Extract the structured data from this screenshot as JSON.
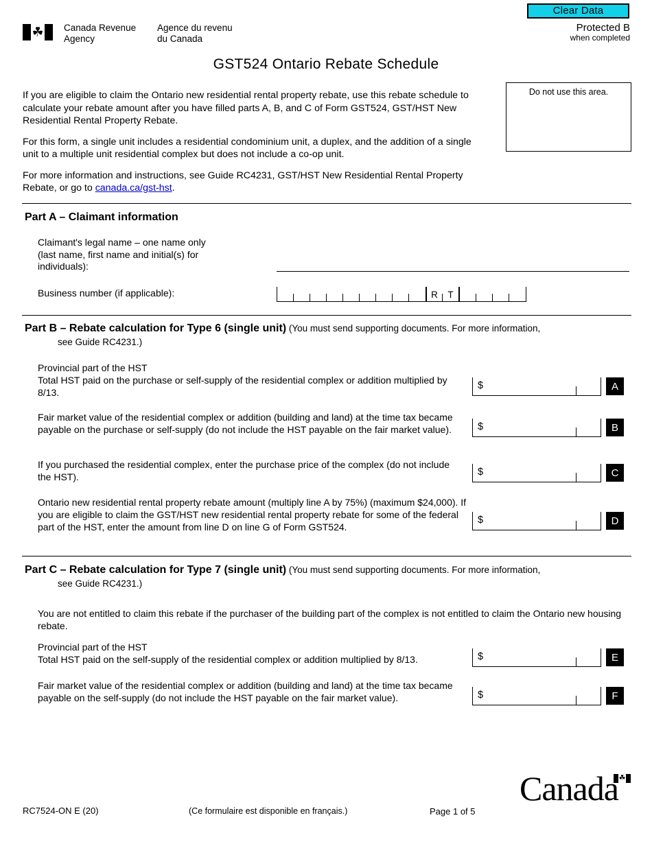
{
  "header": {
    "clear_data_label": "Clear Data",
    "protected_main": "Protected B",
    "protected_sub": "when completed",
    "cra_en": "Canada Revenue\nAgency",
    "cra_fr": "Agence du revenu\ndu Canada",
    "maple_leaf": "☘",
    "form_title": "GST524 Ontario Rebate Schedule"
  },
  "intro": {
    "p1": "If you are eligible to claim the Ontario new residential rental property rebate, use this rebate schedule to calculate your rebate amount after you have filled parts A, B, and C of Form GST524, GST/HST New Residential Rental Property Rebate.",
    "p2": "For this form, a single unit includes a residential condominium unit, a duplex, and the addition of a single unit to a multiple unit residential complex but does not include a co-op unit.",
    "p3_before": "For more information and instructions, see Guide RC4231, GST/HST New Residential Rental Property Rebate, or go to ",
    "p3_link": "canada.ca/gst-hst",
    "p3_after": ".",
    "do_not_use": "Do not use this area."
  },
  "part_a": {
    "heading": "Part A – Claimant information",
    "name_label": "Claimant's legal name – one name only\n(last name, first name and initial(s) for\nindividuals):",
    "bn_label": "Business number (if applicable):",
    "bn_value": "",
    "rt_r": "R",
    "rt_t": "T",
    "name_value": ""
  },
  "part_b": {
    "heading_bold": "Part B – Rebate calculation for Type 6 (single unit)",
    "heading_normal": " (You must send supporting documents. For more information,",
    "heading_cont": "see Guide RC4231.)",
    "lines": [
      {
        "text": "Provincial part of the HST\nTotal HST paid on the purchase or self-supply of the residential complex or addition multiplied by 8/13.",
        "badge": "A",
        "dollar": "$",
        "value": ""
      },
      {
        "text": "Fair market value of the residential complex or addition (building and land) at the time tax became payable on the purchase or self-supply (do not include the HST payable on the fair market value).",
        "badge": "B",
        "dollar": "$",
        "value": ""
      },
      {
        "text": "If you purchased the residential complex, enter the purchase price of the complex (do not include the HST).",
        "badge": "C",
        "dollar": "$",
        "value": ""
      },
      {
        "text": "Ontario new residential rental property rebate amount (multiply line A by 75%) (maximum $24,000). If you are eligible to claim the GST/HST new residential rental property rebate for some of the federal part of the HST, enter the amount from line D on line G of Form GST524.",
        "badge": "D",
        "dollar": "$",
        "value": ""
      }
    ]
  },
  "part_c": {
    "heading_bold": "Part C – Rebate calculation for Type 7 (single unit)",
    "heading_normal": " (You must send supporting documents. For more information,",
    "heading_cont": "see Guide RC4231.)",
    "notice": "You are not entitled to claim this rebate if the purchaser of the building part of the complex is not entitled to claim the Ontario new housing rebate.",
    "lines": [
      {
        "text": "Provincial part of the HST\nTotal HST paid on the self-supply of the residential complex or addition multiplied by 8/13.",
        "badge": "E",
        "dollar": "$",
        "value": ""
      },
      {
        "text": "Fair market value of the residential complex or addition (building and land) at the time tax became payable on the self-supply (do not include the HST payable on the fair market value).",
        "badge": "F",
        "dollar": "$",
        "value": ""
      }
    ]
  },
  "footer": {
    "form_code": "RC7524-ON E (20)",
    "french_note": "(Ce formulaire est disponible en français.)",
    "page_number": "Page 1 of 5",
    "wordmark": "Canada",
    "maple_leaf": "☘"
  },
  "colors": {
    "clear_data_bg": "#12d0e8",
    "link": "#0000cc",
    "badge_bg": "#000000"
  }
}
